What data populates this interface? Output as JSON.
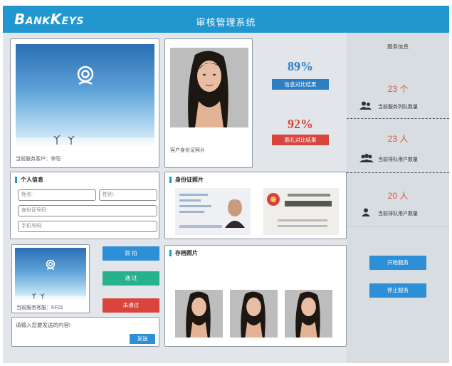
{
  "header": {
    "logo": "BankEys",
    "title": "审核管理系统"
  },
  "customer_camera": {
    "caption": "当前服务客户：李阳"
  },
  "id_photo_card": {
    "caption": "客户身份证照片",
    "info_match_percent": "89%",
    "info_match_label": "信息对比结果",
    "info_color": "#2d7fc1",
    "face_match_percent": "92%",
    "face_match_label": "面孔对比结果",
    "face_color": "#d9453d"
  },
  "personal_info": {
    "title": "个人信息",
    "name_placeholder": "姓名:",
    "gender_placeholder": "性别:",
    "id_number_placeholder": "身份证号码:",
    "phone_placeholder": "手机号码:"
  },
  "id_card_photos": {
    "title": "身份证照片"
  },
  "agent_camera": {
    "caption": "当前服务客服：KF01"
  },
  "actions": {
    "capture": "抓 拍",
    "approve": "通 过",
    "reject": "未通过",
    "capture_color": "#2d8fd6",
    "approve_color": "#27b28e",
    "reject_color": "#d9453d"
  },
  "message": {
    "placeholder": "请输入您要发送的内容!",
    "send": "发送"
  },
  "archive_photos": {
    "title": "存档照片"
  },
  "service_info": {
    "title": "服务信息",
    "queue_count": "23 个",
    "queue_label": "当前服务列队数量",
    "waiting_users": "23 人",
    "waiting_label": "当前排队用户数量",
    "queued_users": "20 人",
    "queued_label": "当前排队用户数量",
    "start_button": "开始服务",
    "stop_button": "停止服务"
  }
}
